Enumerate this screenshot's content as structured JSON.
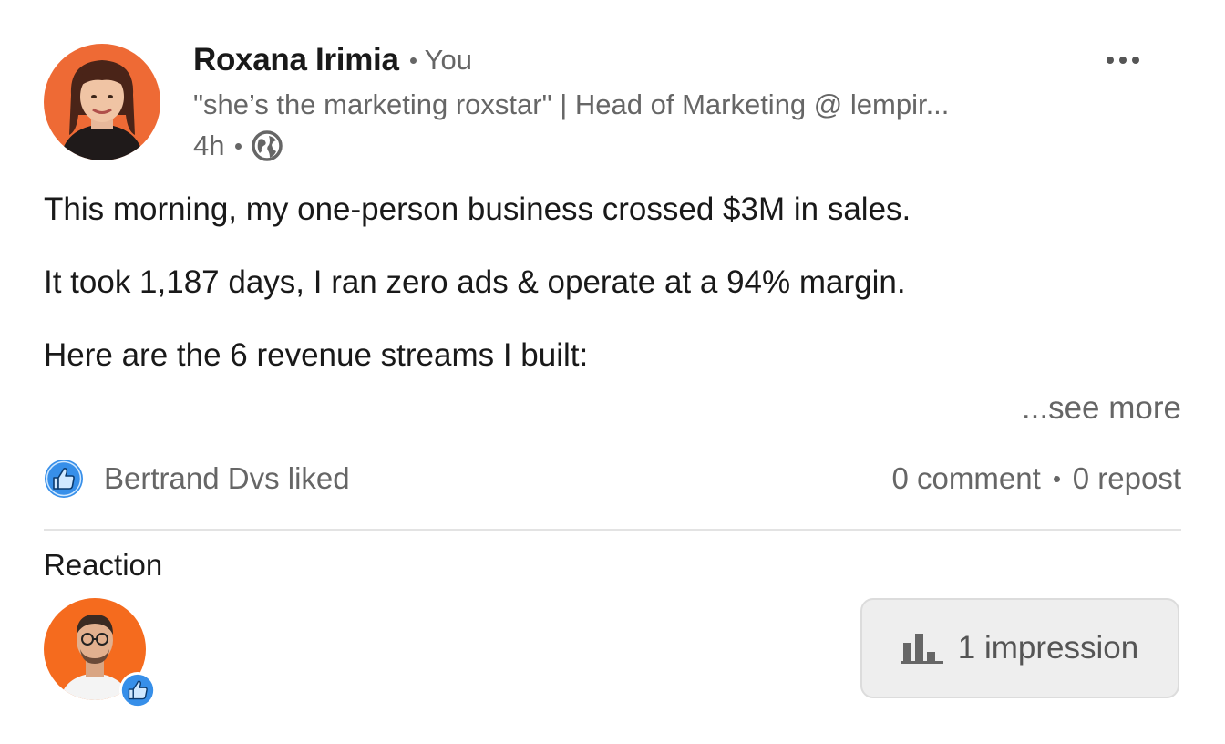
{
  "post": {
    "author_name": "Roxana Irimia",
    "relationship": "You",
    "headline": "\"she’s the marketing roxstar\" | Head of Marketing @ lempir...",
    "time_ago": "4h",
    "visibility_icon": "globe-icon",
    "body_lines": [
      "This morning, my one-person business crossed $3M in sales.",
      "It took 1,187 days, I ran zero ads & operate at a 94% margin.",
      "Here are the 6 revenue streams I built:"
    ],
    "see_more_label": "...see more"
  },
  "social": {
    "liked_by_text": "Bertrand Dvs liked",
    "comments_label": "0 comment",
    "reposts_label": "0 repost",
    "like_icon": "thumbs-up-icon"
  },
  "reactions": {
    "title": "Reaction",
    "reactors": [
      {
        "reaction": "like"
      }
    ]
  },
  "impressions": {
    "label": "1 impression",
    "icon": "bar-chart-icon"
  },
  "colors": {
    "like_blue": "#378fe9",
    "avatar_orange": "#ee6a35",
    "reactor_orange": "#f56b1e",
    "secondary_text": "#666666"
  }
}
